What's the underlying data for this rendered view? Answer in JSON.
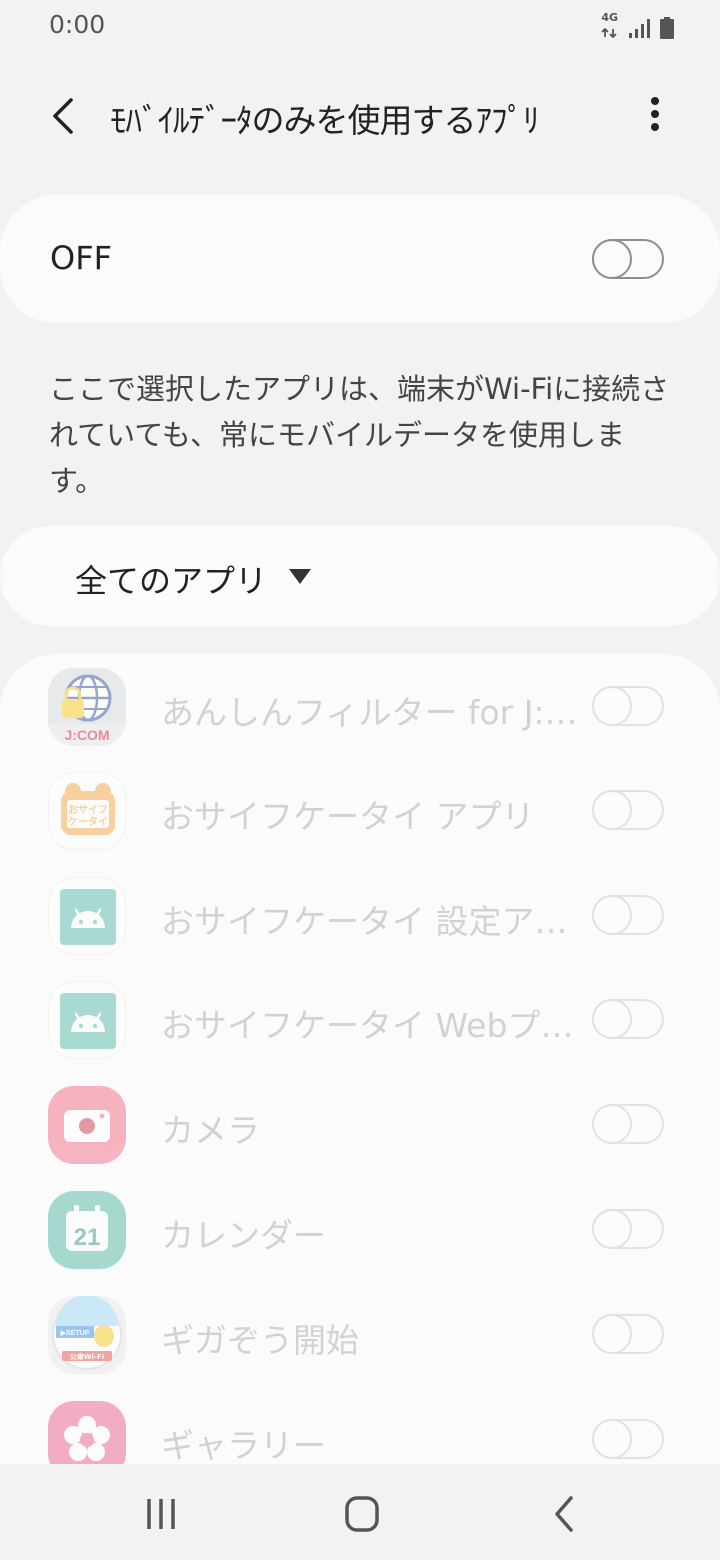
{
  "status_bar": {
    "time": "0:00",
    "network": "4G",
    "icons": [
      "data-transfer-icon",
      "signal-icon",
      "battery-icon"
    ]
  },
  "header": {
    "title": "ﾓﾊﾞｲﾙﾃﾞｰﾀのみを使用するｱﾌﾟﾘ",
    "back_icon": "back-arrow-icon",
    "more_icon": "more-options-icon"
  },
  "master_toggle": {
    "label": "OFF",
    "state": "off"
  },
  "description": "ここで選択したアプリは、端末がWi-Fiに接続されていても、常にモバイルデータを使用します。",
  "filter": {
    "label": "全てのアプリ",
    "icon": "dropdown-triangle-icon"
  },
  "apps": [
    {
      "name": "あんしんフィルター for J:COM",
      "icon": "jcom-filter-icon",
      "enabled": false
    },
    {
      "name": "おサイフケータイ アプリ",
      "icon": "osaifu-keitai-icon",
      "enabled": false
    },
    {
      "name": "おサイフケータイ 設定アプリ",
      "icon": "android-icon",
      "enabled": false
    },
    {
      "name": "おサイフケータイ Webプラグイン",
      "icon": "android-icon",
      "enabled": false
    },
    {
      "name": "カメラ",
      "icon": "camera-icon",
      "enabled": false
    },
    {
      "name": "カレンダー",
      "icon": "calendar-icon",
      "enabled": false
    },
    {
      "name": "ギガぞう開始",
      "icon": "gigazo-icon",
      "enabled": false
    },
    {
      "name": "ギャラリー",
      "icon": "gallery-icon",
      "enabled": false
    }
  ],
  "icon_labels": {
    "jcom": "J:COM",
    "osaifu": "おサイフ ケータイ",
    "calendar_day": "21",
    "gigazo_setup": "▶SETUP",
    "gigazo_wifi": "公衆Wi-Fi"
  },
  "colors": {
    "background": "#f2f2f2",
    "card": "#fbfbfb",
    "disabled_text": "#d2d2d2",
    "camera": "#f05a78",
    "calendar": "#3fb09a",
    "gallery": "#e8507e",
    "osaifu": "#f59a2e",
    "android_tile": "#45b2a3"
  },
  "nav_bar": {
    "recent_icon": "recent-apps-icon",
    "home_icon": "home-icon",
    "back_icon": "nav-back-icon"
  }
}
